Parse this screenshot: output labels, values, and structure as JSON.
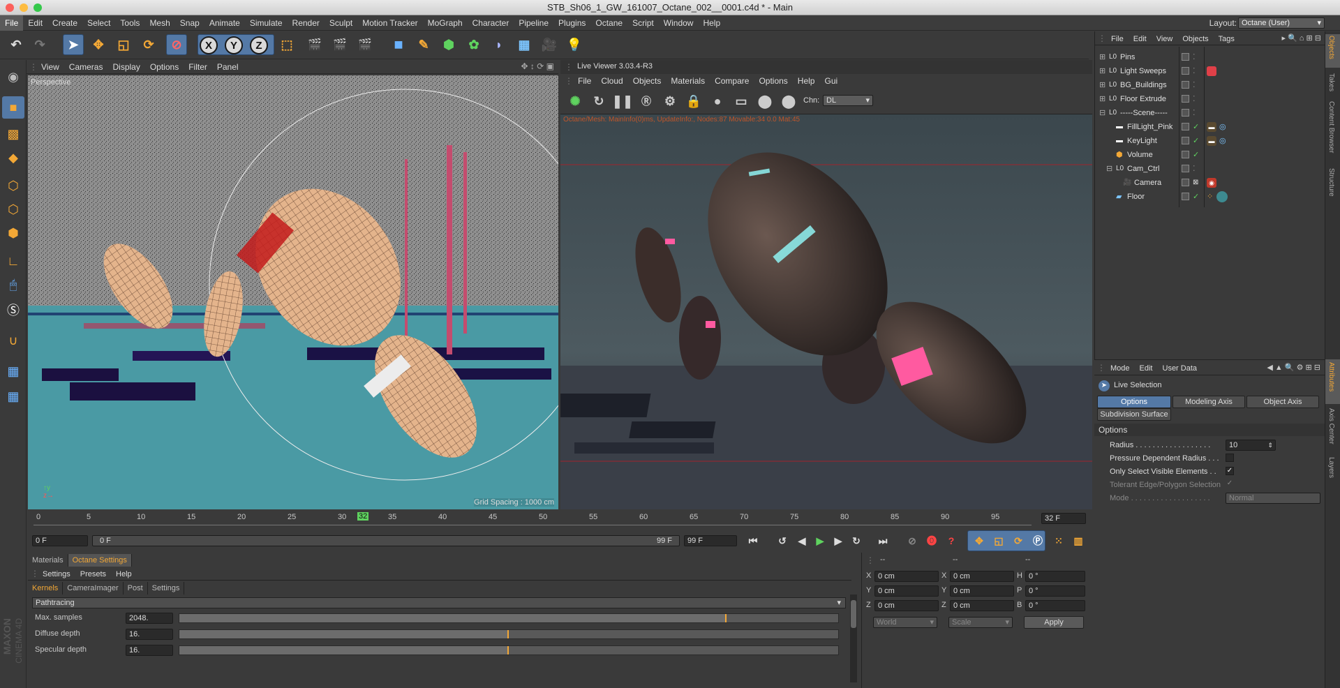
{
  "window": {
    "title": "STB_Sh06_1_GW_161007_Octane_002__0001.c4d * - Main"
  },
  "menubar": {
    "items": [
      "File",
      "Edit",
      "Create",
      "Select",
      "Tools",
      "Mesh",
      "Snap",
      "Animate",
      "Simulate",
      "Render",
      "Sculpt",
      "Motion Tracker",
      "MoGraph",
      "Character",
      "Pipeline",
      "Plugins",
      "Octane",
      "Script",
      "Window",
      "Help"
    ],
    "layout_label": "Layout:",
    "layout_value": "Octane (User)"
  },
  "viewport": {
    "menu": [
      "View",
      "Cameras",
      "Display",
      "Options",
      "Filter",
      "Panel"
    ],
    "label": "Perspective",
    "grid_spacing": "Grid Spacing : 1000 cm"
  },
  "live_viewer": {
    "title": "Live Viewer 3.03.4-R3",
    "menu": [
      "File",
      "Cloud",
      "Objects",
      "Materials",
      "Compare",
      "Options",
      "Help",
      "Gui"
    ],
    "chn_label": "Chn:",
    "chn_value": "DL",
    "status": "Octane/Mesh: MainInfo(0)ms, UpdateInfo:, Nodes:87 Movable:34  0.0 Mat:45"
  },
  "timeline": {
    "ticks": [
      "0",
      "5",
      "10",
      "15",
      "20",
      "25",
      "30",
      "35",
      "40",
      "45",
      "50",
      "55",
      "60",
      "65",
      "70",
      "75",
      "80",
      "85",
      "90",
      "95"
    ],
    "current": "32",
    "end_field": "32 F"
  },
  "transport": {
    "start": "0 F",
    "range_start": "0 F",
    "range_end": "99 F",
    "end": "99 F"
  },
  "bottom_panel": {
    "tabs": [
      "Materials",
      "Octane Settings"
    ],
    "menu": [
      "Settings",
      "Presets",
      "Help"
    ],
    "subtabs": [
      "Kernels",
      "CameraImager",
      "Post",
      "Settings"
    ],
    "kernel": "Pathtracing",
    "params": [
      {
        "label": "Max. samples",
        "value": "2048.",
        "fill": 0.83
      },
      {
        "label": "Diffuse depth",
        "value": "16.",
        "fill": 0.5
      },
      {
        "label": "Specular depth",
        "value": "16.",
        "fill": 0.5
      }
    ]
  },
  "coords": {
    "headers": [
      "--",
      "--",
      "--"
    ],
    "rows": [
      {
        "a": "X",
        "av": "0 cm",
        "b": "X",
        "bv": "0 cm",
        "c": "H",
        "cv": "0 °"
      },
      {
        "a": "Y",
        "av": "0 cm",
        "b": "Y",
        "bv": "0 cm",
        "c": "P",
        "cv": "0 °"
      },
      {
        "a": "Z",
        "av": "0 cm",
        "b": "Z",
        "bv": "0 cm",
        "c": "B",
        "cv": "0 °"
      }
    ],
    "world": "World",
    "scale": "Scale",
    "apply": "Apply"
  },
  "objects": {
    "menu": [
      "File",
      "Edit",
      "View",
      "Objects",
      "Tags"
    ],
    "items": [
      "Pins",
      "Light Sweeps",
      "BG_Buildings",
      "Floor Extrude",
      "-----Scene-----",
      "FillLight_Pink",
      "KeyLight",
      "Volume",
      "Cam_Ctrl",
      "Camera",
      "Floor"
    ]
  },
  "attributes": {
    "menu": [
      "Mode",
      "Edit",
      "User Data"
    ],
    "tool": "Live Selection",
    "tabs": [
      "Options",
      "Modeling Axis",
      "Object Axis",
      "Subdivision Surface"
    ],
    "section": "Options",
    "params": [
      {
        "label": "Radius . . . . . . . . . . . . . . . . . .",
        "value": "10"
      },
      {
        "label": "Pressure Dependent Radius . . .",
        "value": ""
      },
      {
        "label": "Only Select Visible Elements . .",
        "value": "✓"
      },
      {
        "label": "Tolerant Edge/Polygon Selection",
        "value": "✓"
      },
      {
        "label": "Mode . . . . . . . . . . . . . . . . . . .",
        "value": "Normal"
      }
    ]
  },
  "side_tabs": [
    "Objects",
    "Takes",
    "Content Browser",
    "Structure",
    "Attributes",
    "Axis Center",
    "Layers"
  ],
  "brand": {
    "line1": "MAXON",
    "line2": "CINEMA 4D"
  }
}
